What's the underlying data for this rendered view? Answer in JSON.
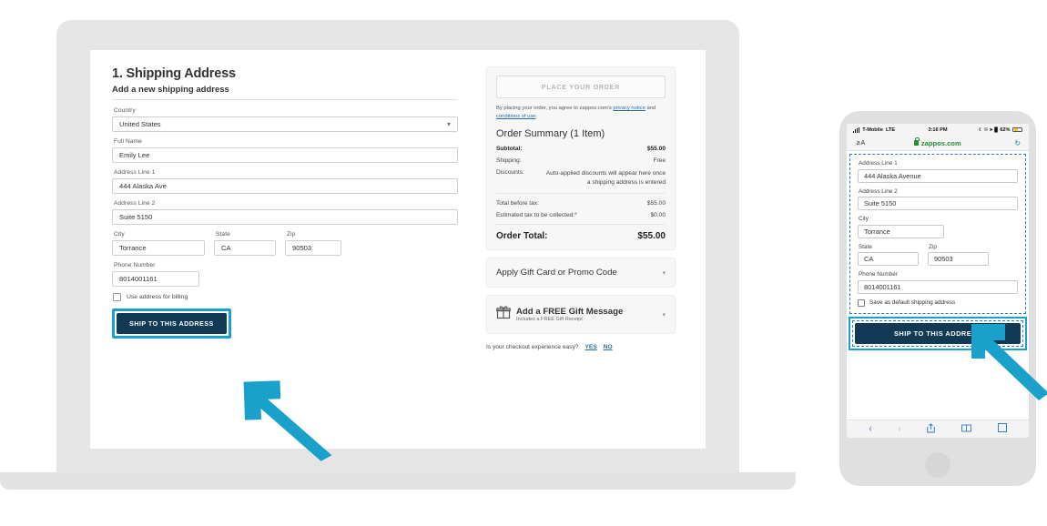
{
  "theme": {
    "accent_teal": "#19A0CB",
    "cta_navy": "#123A55",
    "link_blue": "#2b6ca3",
    "device_gray": "#e5e5e5"
  },
  "laptop": {
    "section_number_title": "1. Shipping Address",
    "subtitle": "Add a new shipping address",
    "fields": {
      "country_label": "Country",
      "country_value": "United States",
      "fullname_label": "Full Name",
      "fullname_value": "Emily Lee",
      "address1_label": "Address Line 1",
      "address1_value": "444 Alaska Ave",
      "address2_label": "Address Line 2",
      "address2_value": "Suite 5150",
      "city_label": "City",
      "city_value": "Torrance",
      "state_label": "State",
      "state_value": "CA",
      "zip_label": "Zip",
      "zip_value": "90503",
      "phone_label": "Phone Number",
      "phone_value": "8014001161"
    },
    "billing_checkbox_label": "Use address for billing",
    "ship_button_label": "SHIP TO THIS ADDRESS",
    "summary": {
      "place_order_label": "PLACE YOUR ORDER",
      "legal_prefix": "By placing your order, you agree to zappos.com's ",
      "legal_link1": "privacy notice",
      "legal_mid": " and ",
      "legal_link2": "conditions of use",
      "legal_suffix": ".",
      "heading": "Order Summary (1 Item)",
      "rows": [
        {
          "label": "Subtotal:",
          "value": "$55.00",
          "bold": true
        },
        {
          "label": "Shipping:",
          "value": "Free",
          "bold": false
        }
      ],
      "discounts_label": "Discounts:",
      "discounts_value": "Auto-applied discounts will appear here once a shipping address is entered",
      "total_before_tax_label": "Total before tax:",
      "total_before_tax_value": "$55.00",
      "est_tax_label": "Estimated tax to be collected:*",
      "est_tax_value": "$0.00",
      "order_total_label": "Order Total:",
      "order_total_value": "$55.00"
    },
    "promo_accordion_label": "Apply Gift Card or Promo Code",
    "gift_accordion_title": "Add a FREE Gift Message",
    "gift_accordion_sub": "Includes a FREE Gift Receipt",
    "feedback_question": "Is your checkout experience easy?",
    "feedback_yes": "YES",
    "feedback_no": "NO"
  },
  "phone": {
    "status": {
      "carrier": "T-Mobile",
      "network": "LTE",
      "time": "3:16 PM",
      "battery_percent": "62%",
      "indicator_glyphs": "☾ ☉ ➤ █"
    },
    "browser": {
      "text_size_label": "ａA",
      "url": "zappos.com",
      "reload_glyph": "↻"
    },
    "fields": {
      "address1_label": "Address Line 1",
      "address1_value": "444 Alaska Avenue",
      "address2_label": "Address Line 2",
      "address2_value": "Suite 5150",
      "city_label": "City",
      "city_value": "Torrance",
      "state_label": "State",
      "state_value": "CA",
      "zip_label": "Zip",
      "zip_value": "90503",
      "phone_label": "Phone Number",
      "phone_value": "8014001161"
    },
    "default_checkbox_label": "Save as default shipping address",
    "ship_button_label": "SHIP TO THIS ADDRESS",
    "toolbar": {
      "back": "‹",
      "forward": "›",
      "share": "⇧",
      "bookmarks": "☷"
    }
  }
}
